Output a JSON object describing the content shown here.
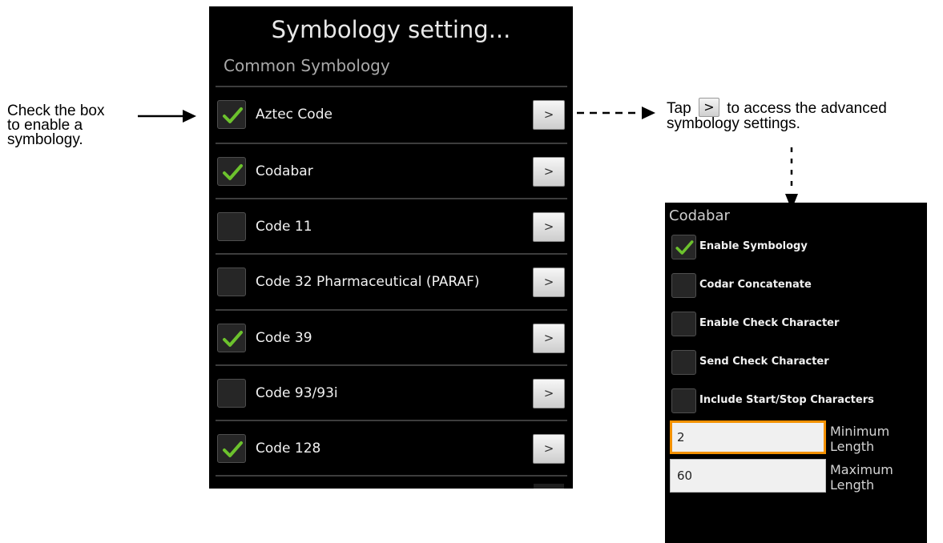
{
  "annotations": {
    "left_lines": [
      "Check the box",
      "to enable a",
      "symbology."
    ],
    "right_pre": "Tap",
    "right_key": ">",
    "right_post": "to access the advanced",
    "right_line2": "symbology settings."
  },
  "screen": {
    "title": "Symbology setting...",
    "section": "Common Symbology",
    "arrow_label": ">",
    "items": [
      {
        "label": "Aztec Code",
        "checked": true
      },
      {
        "label": "Codabar",
        "checked": true
      },
      {
        "label": "Code 11",
        "checked": false
      },
      {
        "label": "Code 32 Pharmaceutical (PARAF)",
        "checked": false
      },
      {
        "label": "Code 39",
        "checked": true
      },
      {
        "label": "Code 93/93i",
        "checked": false
      },
      {
        "label": "Code 128",
        "checked": true
      }
    ]
  },
  "panel": {
    "title": "Codabar",
    "options": [
      {
        "label": "Enable Symbology",
        "checked": true
      },
      {
        "label": "Codar Concatenate",
        "checked": false
      },
      {
        "label": "Enable Check Character",
        "checked": false
      },
      {
        "label": "Send Check Character",
        "checked": false
      },
      {
        "label": "Include Start/Stop Characters",
        "checked": false
      }
    ],
    "min_value": "2",
    "min_label_1": "Minimum",
    "min_label_2": "Length",
    "max_value": "60",
    "max_label_1": "Maximum",
    "max_label_2": "Length"
  },
  "colors": {
    "check": "#6cc22d",
    "focus": "#f39100"
  }
}
